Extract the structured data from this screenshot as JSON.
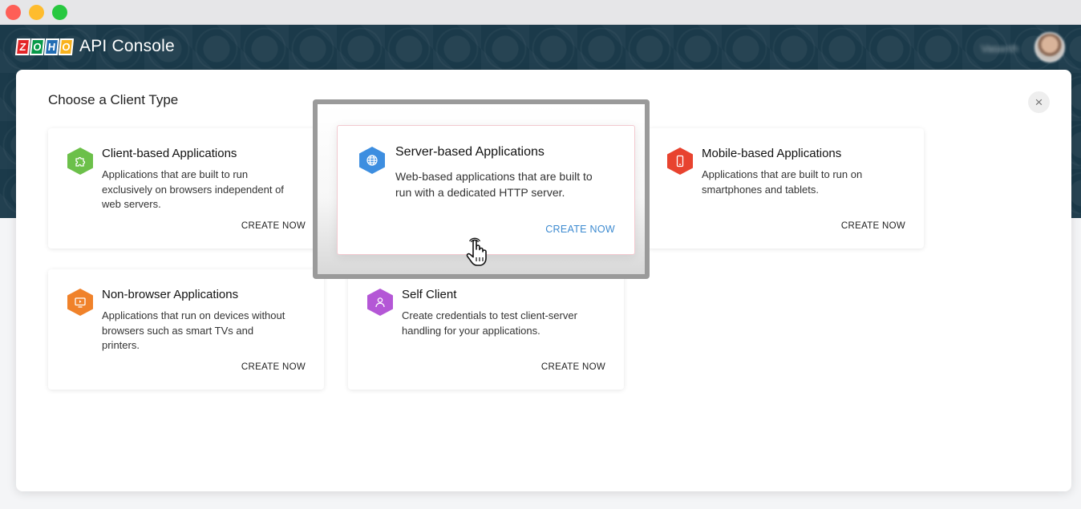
{
  "window": {
    "controls": [
      "close",
      "minimize",
      "maximize"
    ]
  },
  "header": {
    "logo_letters": [
      "Z",
      "O",
      "H",
      "O"
    ],
    "app_title": "API Console",
    "user_name": "Vasanth"
  },
  "modal": {
    "title": "Choose a Client Type",
    "close_label": "×",
    "cards": [
      {
        "title": "Client-based Applications",
        "description": "Applications that are built to run exclusively on browsers independent of web servers.",
        "cta": "CREATE NOW",
        "icon": "puzzle-icon",
        "color": "#6cc04a"
      },
      {
        "title": "Server-based Applications",
        "description": "Web-based applications that are built to run with a dedicated HTTP server.",
        "cta": "CREATE NOW",
        "icon": "globe-icon",
        "color": "#3d8ee0",
        "highlighted": true
      },
      {
        "title": "Mobile-based Applications",
        "description": "Applications that are built to run on smartphones and tablets.",
        "cta": "CREATE NOW",
        "icon": "mobile-icon",
        "color": "#e8432f"
      },
      {
        "title": "Non-browser Applications",
        "description": "Applications that run on devices without browsers such as smart TVs and printers.",
        "cta": "CREATE NOW",
        "icon": "tv-icon",
        "color": "#f0822a"
      },
      {
        "title": "Self Client",
        "description": "Create credentials to test client-server handling for your applications.",
        "cta": "CREATE NOW",
        "icon": "user-icon",
        "color": "#b457d6"
      }
    ]
  }
}
